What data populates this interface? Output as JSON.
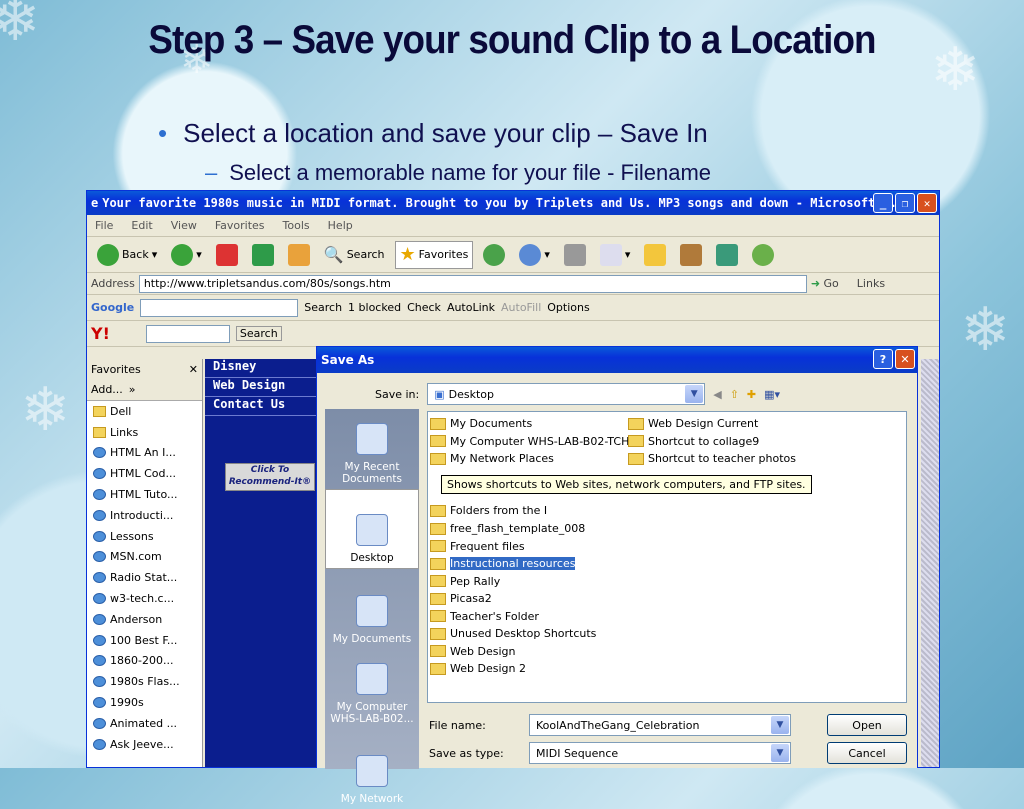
{
  "slide": {
    "title": "Step 3 – Save your sound Clip to a Location",
    "bullet1": "Select a location and save your clip – Save In",
    "bullet2": "Select a memorable name for your file - Filename"
  },
  "ie": {
    "title": "Your favorite 1980s music in MIDI format. Brought to you by Triplets and Us. MP3 songs and down - Microsoft I...",
    "menu": [
      "File",
      "Edit",
      "View",
      "Favorites",
      "Tools",
      "Help"
    ],
    "toolbar": {
      "back": "Back",
      "search": "Search",
      "favorites": "Favorites"
    },
    "address": {
      "label": "Address",
      "url": "http://www.tripletsandus.com/80s/songs.htm",
      "go": "Go",
      "links": "Links"
    },
    "google": {
      "logo": "Google",
      "search": "Search",
      "blocked": "1 blocked",
      "check": "Check",
      "autolink": "AutoLink",
      "autofill": "AutoFill",
      "options": "Options"
    },
    "yahoo": {
      "logo": "Y!",
      "search": "Search"
    },
    "favorites": {
      "header": "Favorites",
      "add": "Add...",
      "items": [
        "Dell",
        "Links",
        "HTML An I...",
        "HTML Cod...",
        "HTML Tuto...",
        "Introducti...",
        "Lessons",
        "MSN.com",
        "Radio Stat...",
        "w3-tech.c...",
        "Anderson",
        "100 Best F...",
        "1860-200...",
        "1980s Flas...",
        "1990s",
        "Animated ...",
        "Ask Jeeve..."
      ]
    },
    "page_links": [
      "Disney",
      "Web Design",
      "Contact Us"
    ],
    "recommend": "Click To Recommend-It®"
  },
  "dialog": {
    "title": "Save As",
    "save_in_label": "Save in:",
    "save_in": "Desktop",
    "places": [
      "My Recent Documents",
      "Desktop",
      "My Documents",
      "My Computer WHS-LAB-B02...",
      "My Network"
    ],
    "files_col1": [
      "My Documents",
      "My Computer WHS-LAB-B02-TCH",
      "My Network Places",
      "Folders from the I",
      "free_flash_template_008",
      "Frequent files",
      "Instructional resources",
      "Pep Rally",
      "Picasa2",
      "Teacher's Folder",
      "Unused Desktop Shortcuts",
      "Web Design",
      "Web Design 2"
    ],
    "files_col2": [
      "Web Design Current",
      "Shortcut to collage9",
      "Shortcut to teacher photos"
    ],
    "tooltip": "Shows shortcuts to Web sites, network computers, and FTP sites.",
    "filename_label": "File name:",
    "filename": "KoolAndTheGang_Celebration",
    "type_label": "Save as type:",
    "type": "MIDI Sequence",
    "open": "Open",
    "cancel": "Cancel"
  }
}
